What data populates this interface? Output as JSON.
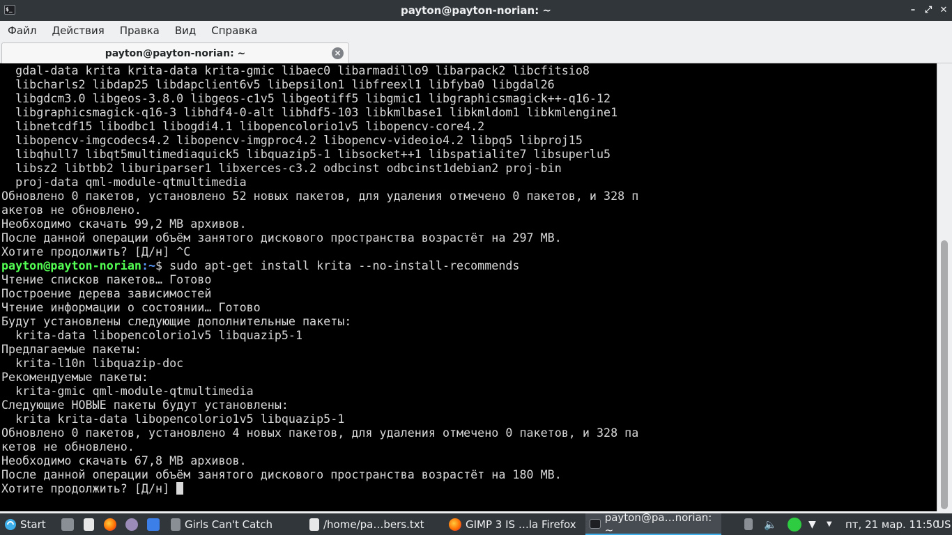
{
  "window": {
    "title": "payton@payton-norian: ~",
    "app_icon_glyph": "$_",
    "controls": {
      "minimize": "–",
      "maximize": "⤢",
      "close": "✕"
    }
  },
  "menu": [
    "Файл",
    "Действия",
    "Правка",
    "Вид",
    "Справка"
  ],
  "tab": {
    "title": "payton@payton-norian: ~"
  },
  "terminal": {
    "lines": [
      "  gdal-data krita krita-data krita-gmic libaec0 libarmadillo9 libarpack2 libcfitsio8",
      "  libcharls2 libdap25 libdapclient6v5 libepsilon1 libfreexl1 libfyba0 libgdal26",
      "  libgdcm3.0 libgeos-3.8.0 libgeos-c1v5 libgeotiff5 libgmic1 libgraphicsmagick++-q16-12",
      "  libgraphicsmagick-q16-3 libhdf4-0-alt libhdf5-103 libkmlbase1 libkmldom1 libkmlengine1",
      "  libnetcdf15 libodbc1 libogdi4.1 libopencolorio1v5 libopencv-core4.2",
      "  libopencv-imgcodecs4.2 libopencv-imgproc4.2 libopencv-videoio4.2 libpq5 libproj15",
      "  libqhull7 libqt5multimediaquick5 libquazip5-1 libsocket++1 libspatialite7 libsuperlu5",
      "  libsz2 libtbb2 liburiparser1 libxerces-c3.2 odbcinst odbcinst1debian2 proj-bin",
      "  proj-data qml-module-qtmultimedia",
      "Обновлено 0 пакетов, установлено 52 новых пакетов, для удаления отмечено 0 пакетов, и 328 п",
      "акетов не обновлено.",
      "Необходимо скачать 99,2 MB архивов.",
      "После данной операции объём занятого дискового пространства возрастёт на 297 MB.",
      "Хотите продолжить? [Д/н] ^C"
    ],
    "prompt": {
      "user_host": "payton@payton-norian",
      "path": ":~",
      "symbol": "$ ",
      "command": "sudo apt-get install krita --no-install-recommends"
    },
    "lines_after": [
      "Чтение списков пакетов… Готово",
      "Построение дерева зависимостей",
      "Чтение информации о состоянии… Готово",
      "Будут установлены следующие дополнительные пакеты:",
      "  krita-data libopencolorio1v5 libquazip5-1",
      "Предлагаемые пакеты:",
      "  krita-l10n libquazip-doc",
      "Рекомендуемые пакеты:",
      "  krita-gmic qml-module-qtmultimedia",
      "Следующие НОВЫЕ пакеты будут установлены:",
      "  krita krita-data libopencolorio1v5 libquazip5-1",
      "Обновлено 0 пакетов, установлено 4 новых пакетов, для удаления отмечено 0 пакетов, и 328 па",
      "кетов не обновлено.",
      "Необходимо скачать 67,8 MB архивов.",
      "После данной операции объём занятого дискового пространства возрастёт на 180 MB."
    ],
    "last_line": "Хотите продолжить? [Д/н] "
  },
  "taskbar": {
    "start_label": "Start",
    "tasks": [
      {
        "label": "Girls Can't Catch",
        "icon": "audio-player-icon"
      },
      {
        "label": "/home/pa…bers.txt",
        "icon": "text-editor-icon"
      },
      {
        "label": "GIMP 3 IS …la Firefox",
        "icon": "firefox-icon"
      },
      {
        "label": "payton@pa…norian: ~",
        "icon": "terminal-icon",
        "active": true
      }
    ],
    "clock": "пт, 21 мар. 11:50",
    "keyboard_layout": "US"
  },
  "colors": {
    "accent": "#3daee9",
    "prompt_user": "#54ff54",
    "prompt_path": "#5c9cff",
    "terminal_bg": "#000000",
    "terminal_fg": "#d9d9d9"
  }
}
